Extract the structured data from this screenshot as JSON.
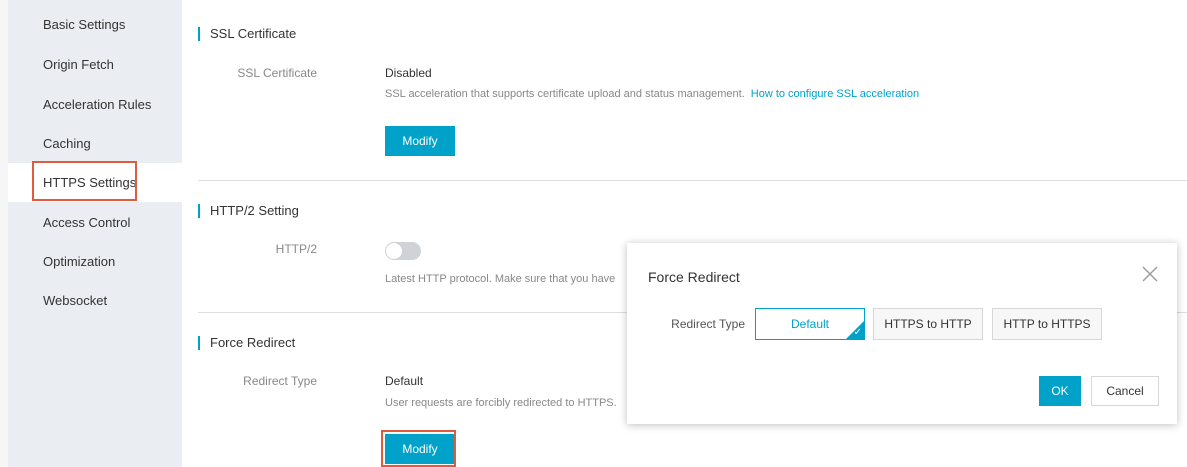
{
  "sidebar": {
    "items": [
      {
        "label": "Basic Settings"
      },
      {
        "label": "Origin Fetch"
      },
      {
        "label": "Acceleration Rules"
      },
      {
        "label": "Caching"
      },
      {
        "label": "HTTPS Settings"
      },
      {
        "label": "Access Control"
      },
      {
        "label": "Optimization"
      },
      {
        "label": "Websocket"
      }
    ],
    "active": "HTTPS Settings"
  },
  "ssl": {
    "title": "SSL Certificate",
    "label": "SSL Certificate",
    "value": "Disabled",
    "desc": "SSL acceleration that supports certificate upload and status management.",
    "link": "How to configure SSL acceleration",
    "modify": "Modify"
  },
  "http2": {
    "title": "HTTP/2 Setting",
    "label": "HTTP/2",
    "enabled": false,
    "desc": "Latest HTTP protocol. Make sure that you have"
  },
  "force_redirect": {
    "title": "Force Redirect",
    "label": "Redirect Type",
    "value": "Default",
    "desc": "User requests are forcibly redirected to HTTPS.",
    "modify": "Modify"
  },
  "modal": {
    "title": "Force Redirect",
    "label": "Redirect Type",
    "options": [
      "Default",
      "HTTPS to HTTP",
      "HTTP to HTTPS"
    ],
    "selected": "Default",
    "ok": "OK",
    "cancel": "Cancel"
  },
  "colors": {
    "accent": "#00a2ca",
    "highlight": "#e05a3d"
  }
}
